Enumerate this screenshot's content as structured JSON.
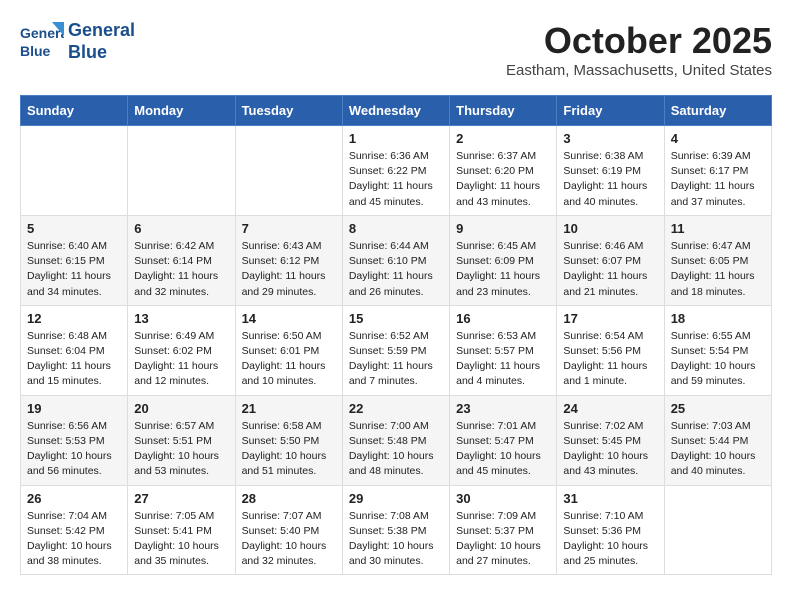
{
  "header": {
    "logo_line1": "General",
    "logo_line2": "Blue",
    "month": "October 2025",
    "location": "Eastham, Massachusetts, United States"
  },
  "weekdays": [
    "Sunday",
    "Monday",
    "Tuesday",
    "Wednesday",
    "Thursday",
    "Friday",
    "Saturday"
  ],
  "weeks": [
    [
      {
        "day": "",
        "info": ""
      },
      {
        "day": "",
        "info": ""
      },
      {
        "day": "",
        "info": ""
      },
      {
        "day": "1",
        "info": "Sunrise: 6:36 AM\nSunset: 6:22 PM\nDaylight: 11 hours\nand 45 minutes."
      },
      {
        "day": "2",
        "info": "Sunrise: 6:37 AM\nSunset: 6:20 PM\nDaylight: 11 hours\nand 43 minutes."
      },
      {
        "day": "3",
        "info": "Sunrise: 6:38 AM\nSunset: 6:19 PM\nDaylight: 11 hours\nand 40 minutes."
      },
      {
        "day": "4",
        "info": "Sunrise: 6:39 AM\nSunset: 6:17 PM\nDaylight: 11 hours\nand 37 minutes."
      }
    ],
    [
      {
        "day": "5",
        "info": "Sunrise: 6:40 AM\nSunset: 6:15 PM\nDaylight: 11 hours\nand 34 minutes."
      },
      {
        "day": "6",
        "info": "Sunrise: 6:42 AM\nSunset: 6:14 PM\nDaylight: 11 hours\nand 32 minutes."
      },
      {
        "day": "7",
        "info": "Sunrise: 6:43 AM\nSunset: 6:12 PM\nDaylight: 11 hours\nand 29 minutes."
      },
      {
        "day": "8",
        "info": "Sunrise: 6:44 AM\nSunset: 6:10 PM\nDaylight: 11 hours\nand 26 minutes."
      },
      {
        "day": "9",
        "info": "Sunrise: 6:45 AM\nSunset: 6:09 PM\nDaylight: 11 hours\nand 23 minutes."
      },
      {
        "day": "10",
        "info": "Sunrise: 6:46 AM\nSunset: 6:07 PM\nDaylight: 11 hours\nand 21 minutes."
      },
      {
        "day": "11",
        "info": "Sunrise: 6:47 AM\nSunset: 6:05 PM\nDaylight: 11 hours\nand 18 minutes."
      }
    ],
    [
      {
        "day": "12",
        "info": "Sunrise: 6:48 AM\nSunset: 6:04 PM\nDaylight: 11 hours\nand 15 minutes."
      },
      {
        "day": "13",
        "info": "Sunrise: 6:49 AM\nSunset: 6:02 PM\nDaylight: 11 hours\nand 12 minutes."
      },
      {
        "day": "14",
        "info": "Sunrise: 6:50 AM\nSunset: 6:01 PM\nDaylight: 11 hours\nand 10 minutes."
      },
      {
        "day": "15",
        "info": "Sunrise: 6:52 AM\nSunset: 5:59 PM\nDaylight: 11 hours\nand 7 minutes."
      },
      {
        "day": "16",
        "info": "Sunrise: 6:53 AM\nSunset: 5:57 PM\nDaylight: 11 hours\nand 4 minutes."
      },
      {
        "day": "17",
        "info": "Sunrise: 6:54 AM\nSunset: 5:56 PM\nDaylight: 11 hours\nand 1 minute."
      },
      {
        "day": "18",
        "info": "Sunrise: 6:55 AM\nSunset: 5:54 PM\nDaylight: 10 hours\nand 59 minutes."
      }
    ],
    [
      {
        "day": "19",
        "info": "Sunrise: 6:56 AM\nSunset: 5:53 PM\nDaylight: 10 hours\nand 56 minutes."
      },
      {
        "day": "20",
        "info": "Sunrise: 6:57 AM\nSunset: 5:51 PM\nDaylight: 10 hours\nand 53 minutes."
      },
      {
        "day": "21",
        "info": "Sunrise: 6:58 AM\nSunset: 5:50 PM\nDaylight: 10 hours\nand 51 minutes."
      },
      {
        "day": "22",
        "info": "Sunrise: 7:00 AM\nSunset: 5:48 PM\nDaylight: 10 hours\nand 48 minutes."
      },
      {
        "day": "23",
        "info": "Sunrise: 7:01 AM\nSunset: 5:47 PM\nDaylight: 10 hours\nand 45 minutes."
      },
      {
        "day": "24",
        "info": "Sunrise: 7:02 AM\nSunset: 5:45 PM\nDaylight: 10 hours\nand 43 minutes."
      },
      {
        "day": "25",
        "info": "Sunrise: 7:03 AM\nSunset: 5:44 PM\nDaylight: 10 hours\nand 40 minutes."
      }
    ],
    [
      {
        "day": "26",
        "info": "Sunrise: 7:04 AM\nSunset: 5:42 PM\nDaylight: 10 hours\nand 38 minutes."
      },
      {
        "day": "27",
        "info": "Sunrise: 7:05 AM\nSunset: 5:41 PM\nDaylight: 10 hours\nand 35 minutes."
      },
      {
        "day": "28",
        "info": "Sunrise: 7:07 AM\nSunset: 5:40 PM\nDaylight: 10 hours\nand 32 minutes."
      },
      {
        "day": "29",
        "info": "Sunrise: 7:08 AM\nSunset: 5:38 PM\nDaylight: 10 hours\nand 30 minutes."
      },
      {
        "day": "30",
        "info": "Sunrise: 7:09 AM\nSunset: 5:37 PM\nDaylight: 10 hours\nand 27 minutes."
      },
      {
        "day": "31",
        "info": "Sunrise: 7:10 AM\nSunset: 5:36 PM\nDaylight: 10 hours\nand 25 minutes."
      },
      {
        "day": "",
        "info": ""
      }
    ]
  ]
}
